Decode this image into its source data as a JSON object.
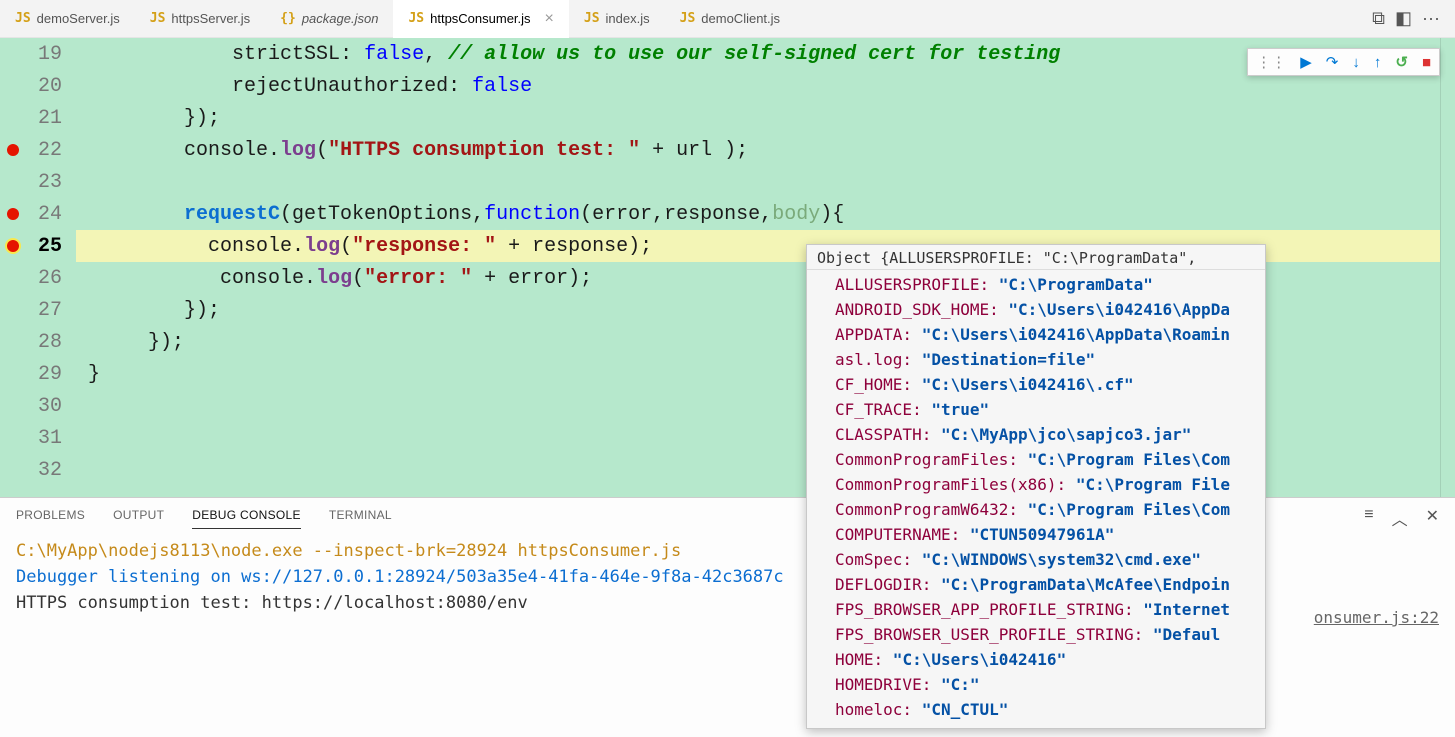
{
  "tabs": [
    {
      "icon": "JS",
      "name": "demoServer.js",
      "italic": false
    },
    {
      "icon": "JS",
      "name": "httpsServer.js",
      "italic": false
    },
    {
      "icon": "{}",
      "name": "package.json",
      "italic": true
    },
    {
      "icon": "JS",
      "name": "httpsConsumer.js",
      "italic": false,
      "active": true,
      "close": "×"
    },
    {
      "icon": "JS",
      "name": "index.js",
      "italic": false
    },
    {
      "icon": "JS",
      "name": "demoClient.js",
      "italic": false
    }
  ],
  "titleIcons": {
    "compare": "⧉",
    "split": "◧",
    "more": "···"
  },
  "debugToolbar": {
    "grip": "⋮⋮",
    "continue": "▶",
    "stepOver": "↷",
    "stepInto": "↓",
    "stepOut": "↑",
    "restart": "↺",
    "stop": "■"
  },
  "lines": [
    {
      "n": 19,
      "bp": false,
      "ibar": "on"
    },
    {
      "n": 20,
      "bp": false,
      "ibar": ""
    },
    {
      "n": 21,
      "bp": false,
      "ibar": ""
    },
    {
      "n": 22,
      "bp": true,
      "ibar": ""
    },
    {
      "n": 23,
      "bp": false,
      "ibar": ""
    },
    {
      "n": 24,
      "bp": true,
      "ibar": ""
    },
    {
      "n": 25,
      "bp": true,
      "cur": true,
      "ibar": "mod",
      "hl": true
    },
    {
      "n": 26,
      "bp": false,
      "ibar": "on"
    },
    {
      "n": 27,
      "bp": false,
      "ibar": ""
    },
    {
      "n": 28,
      "bp": false,
      "ibar": ""
    },
    {
      "n": 29,
      "bp": false,
      "ibar": ""
    },
    {
      "n": 30,
      "bp": false,
      "ibar": ""
    },
    {
      "n": 31,
      "bp": false,
      "ibar": ""
    },
    {
      "n": 32,
      "bp": false,
      "ibar": ""
    }
  ],
  "code": {
    "l19": {
      "a": "strictSSL",
      "b": ": ",
      "c": "false",
      "d": ", ",
      "e": "// allow us to use our self-signed cert for testing"
    },
    "l20": {
      "a": "rejectUnauthorized",
      "b": ": ",
      "c": "false"
    },
    "l21": {
      "a": "});"
    },
    "l22": {
      "a": "console",
      "b": ".",
      "c": "log",
      "d": "(",
      "e": "\"HTTPS consumption test: \"",
      "f": " + ",
      "g": "url",
      "h": " );"
    },
    "l23": {
      "a": ""
    },
    "l24": {
      "a": "requestC",
      "b": "(",
      "c": "getTokenOptions",
      "d": ",",
      "e": "function",
      "f": "(",
      "g": "error",
      "h": ",",
      "i": "response",
      "j": ",",
      "k": "body",
      "l": "){"
    },
    "l25": {
      "a": "console",
      "b": ".",
      "c": "log",
      "d": "(",
      "e": "\"response: \"",
      "f": " + ",
      "g": "response",
      "h": ");"
    },
    "l26": {
      "a": "console",
      "b": ".",
      "c": "log",
      "d": "(",
      "e": "\"error: \"",
      "f": " + ",
      "g": "error",
      "h": ");"
    },
    "l27": {
      "a": "});"
    },
    "l28": {
      "a": "});"
    },
    "l29": {
      "a": "}"
    }
  },
  "hover": {
    "head": "Object {ALLUSERSPROFILE: \"C:\\ProgramData\",",
    "rows": [
      {
        "k": "ALLUSERSPROFILE:",
        "v": "\"C:\\ProgramData\""
      },
      {
        "k": "ANDROID_SDK_HOME:",
        "v": "\"C:\\Users\\i042416\\AppDa"
      },
      {
        "k": "APPDATA:",
        "v": "\"C:\\Users\\i042416\\AppData\\Roamin"
      },
      {
        "k": "asl.log:",
        "v": "\"Destination=file\""
      },
      {
        "k": "CF_HOME:",
        "v": "\"C:\\Users\\i042416\\.cf\""
      },
      {
        "k": "CF_TRACE:",
        "v": "\"true\""
      },
      {
        "k": "CLASSPATH:",
        "v": "\"C:\\MyApp\\jco\\sapjco3.jar\""
      },
      {
        "k": "CommonProgramFiles:",
        "v": "\"C:\\Program Files\\Com"
      },
      {
        "k": "CommonProgramFiles(x86):",
        "v": "\"C:\\Program File"
      },
      {
        "k": "CommonProgramW6432:",
        "v": "\"C:\\Program Files\\Com"
      },
      {
        "k": "COMPUTERNAME:",
        "v": "\"CTUN50947961A\""
      },
      {
        "k": "ComSpec:",
        "v": "\"C:\\WINDOWS\\system32\\cmd.exe\""
      },
      {
        "k": "DEFLOGDIR:",
        "v": "\"C:\\ProgramData\\McAfee\\Endpoin"
      },
      {
        "k": "FPS_BROWSER_APP_PROFILE_STRING:",
        "v": "\"Internet"
      },
      {
        "k": "FPS_BROWSER_USER_PROFILE_STRING:",
        "v": "\"Defaul"
      },
      {
        "k": "HOME:",
        "v": "\"C:\\Users\\i042416\""
      },
      {
        "k": "HOMEDRIVE:",
        "v": "\"C:\""
      },
      {
        "k": "homeloc:",
        "v": "\"CN_CTUL\""
      }
    ]
  },
  "panel": {
    "tabs": [
      {
        "label": "PROBLEMS"
      },
      {
        "label": "OUTPUT"
      },
      {
        "label": "DEBUG CONSOLE",
        "active": true
      },
      {
        "label": "TERMINAL"
      }
    ],
    "icons": {
      "filter": "≡",
      "up": "︿",
      "close": "✕"
    },
    "lines": [
      {
        "cls": "p-cmd",
        "t": "C:\\MyApp\\nodejs8113\\node.exe --inspect-brk=28924 httpsConsumer.js"
      },
      {
        "cls": "p-dbg",
        "t": "Debugger listening on ws://127.0.0.1:28924/503a35e4-41fa-464e-9f8a-42c3687c"
      },
      {
        "cls": "p-out",
        "t": "HTTPS consumption test: https://localhost:8080/env"
      }
    ],
    "src": "onsumer.js:22"
  }
}
